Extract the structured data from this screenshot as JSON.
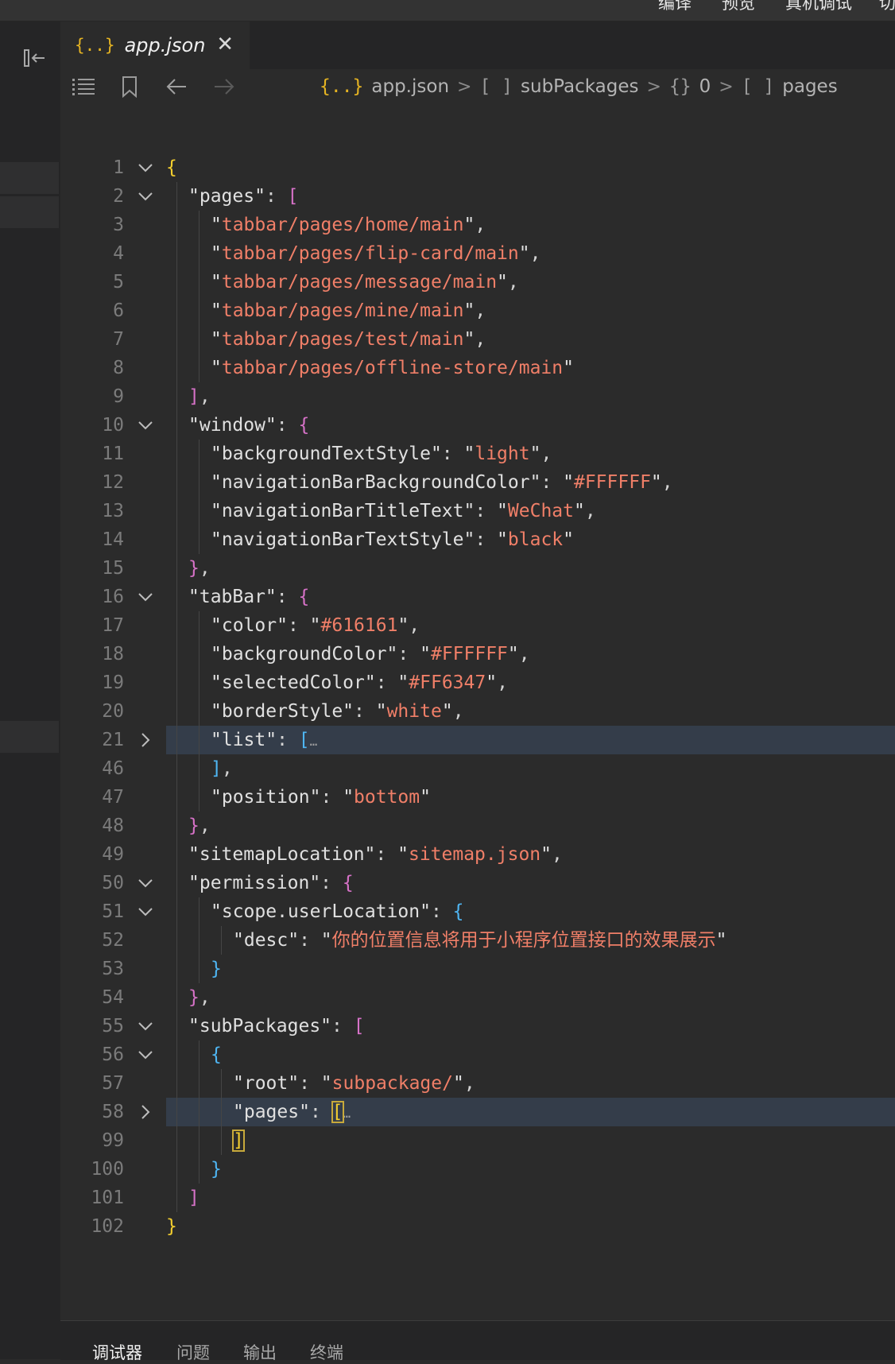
{
  "topbar": {
    "items": [
      "编译",
      "预览",
      "真机调试",
      "切"
    ]
  },
  "tab": {
    "label": "app.json",
    "icon": "json-braces-icon"
  },
  "breadcrumb": {
    "items": [
      {
        "glyph": "{..}",
        "text": "app.json"
      },
      {
        "glyph": "[ ]",
        "text": "subPackages"
      },
      {
        "glyph": "{}",
        "text": "0"
      },
      {
        "glyph": "[ ]",
        "text": "pages"
      }
    ]
  },
  "colors": {
    "string": "#f07f68",
    "bracket_level0": "#f4cf2e",
    "bracket_level1": "#d772c8",
    "bracket_level2": "#4fb6f3",
    "line_highlight": "#343d4a"
  },
  "editor": {
    "lines": [
      {
        "num": "1",
        "fold": "open",
        "indent": 0,
        "tokens": [
          [
            "b0",
            "{"
          ]
        ]
      },
      {
        "num": "2",
        "fold": "open",
        "indent": 1,
        "tokens": [
          [
            "key",
            "\"pages\""
          ],
          [
            "punc",
            ": "
          ],
          [
            "b1",
            "["
          ]
        ]
      },
      {
        "num": "3",
        "indent": 2,
        "tokens": [
          [
            "key",
            "\""
          ],
          [
            "str",
            "tabbar/pages/home/main"
          ],
          [
            "key",
            "\""
          ],
          [
            "punc",
            ","
          ]
        ]
      },
      {
        "num": "4",
        "indent": 2,
        "tokens": [
          [
            "key",
            "\""
          ],
          [
            "str",
            "tabbar/pages/flip-card/main"
          ],
          [
            "key",
            "\""
          ],
          [
            "punc",
            ","
          ]
        ]
      },
      {
        "num": "5",
        "indent": 2,
        "tokens": [
          [
            "key",
            "\""
          ],
          [
            "str",
            "tabbar/pages/message/main"
          ],
          [
            "key",
            "\""
          ],
          [
            "punc",
            ","
          ]
        ]
      },
      {
        "num": "6",
        "indent": 2,
        "tokens": [
          [
            "key",
            "\""
          ],
          [
            "str",
            "tabbar/pages/mine/main"
          ],
          [
            "key",
            "\""
          ],
          [
            "punc",
            ","
          ]
        ]
      },
      {
        "num": "7",
        "indent": 2,
        "tokens": [
          [
            "key",
            "\""
          ],
          [
            "str",
            "tabbar/pages/test/main"
          ],
          [
            "key",
            "\""
          ],
          [
            "punc",
            ","
          ]
        ]
      },
      {
        "num": "8",
        "indent": 2,
        "tokens": [
          [
            "key",
            "\""
          ],
          [
            "str",
            "tabbar/pages/offline-store/main"
          ],
          [
            "key",
            "\""
          ]
        ]
      },
      {
        "num": "9",
        "indent": 1,
        "tokens": [
          [
            "b1",
            "]"
          ],
          [
            "punc",
            ","
          ]
        ]
      },
      {
        "num": "10",
        "fold": "open",
        "indent": 1,
        "tokens": [
          [
            "key",
            "\"window\""
          ],
          [
            "punc",
            ": "
          ],
          [
            "b1",
            "{"
          ]
        ]
      },
      {
        "num": "11",
        "indent": 2,
        "tokens": [
          [
            "key",
            "\"backgroundTextStyle\""
          ],
          [
            "punc",
            ": "
          ],
          [
            "key",
            "\""
          ],
          [
            "str",
            "light"
          ],
          [
            "key",
            "\""
          ],
          [
            "punc",
            ","
          ]
        ]
      },
      {
        "num": "12",
        "indent": 2,
        "tokens": [
          [
            "key",
            "\"navigationBarBackgroundColor\""
          ],
          [
            "punc",
            ": "
          ],
          [
            "key",
            "\""
          ],
          [
            "str",
            "#FFFFFF"
          ],
          [
            "key",
            "\""
          ],
          [
            "punc",
            ","
          ]
        ]
      },
      {
        "num": "13",
        "indent": 2,
        "tokens": [
          [
            "key",
            "\"navigationBarTitleText\""
          ],
          [
            "punc",
            ": "
          ],
          [
            "key",
            "\""
          ],
          [
            "str",
            "WeChat"
          ],
          [
            "key",
            "\""
          ],
          [
            "punc",
            ","
          ]
        ]
      },
      {
        "num": "14",
        "indent": 2,
        "tokens": [
          [
            "key",
            "\"navigationBarTextStyle\""
          ],
          [
            "punc",
            ": "
          ],
          [
            "key",
            "\""
          ],
          [
            "str",
            "black"
          ],
          [
            "key",
            "\""
          ]
        ]
      },
      {
        "num": "15",
        "indent": 1,
        "tokens": [
          [
            "b1",
            "}"
          ],
          [
            "punc",
            ","
          ]
        ]
      },
      {
        "num": "16",
        "fold": "open",
        "indent": 1,
        "tokens": [
          [
            "key",
            "\"tabBar\""
          ],
          [
            "punc",
            ": "
          ],
          [
            "b1",
            "{"
          ]
        ]
      },
      {
        "num": "17",
        "indent": 2,
        "tokens": [
          [
            "key",
            "\"color\""
          ],
          [
            "punc",
            ": "
          ],
          [
            "key",
            "\""
          ],
          [
            "str",
            "#616161"
          ],
          [
            "key",
            "\""
          ],
          [
            "punc",
            ","
          ]
        ]
      },
      {
        "num": "18",
        "indent": 2,
        "tokens": [
          [
            "key",
            "\"backgroundColor\""
          ],
          [
            "punc",
            ": "
          ],
          [
            "key",
            "\""
          ],
          [
            "str",
            "#FFFFFF"
          ],
          [
            "key",
            "\""
          ],
          [
            "punc",
            ","
          ]
        ]
      },
      {
        "num": "19",
        "indent": 2,
        "tokens": [
          [
            "key",
            "\"selectedColor\""
          ],
          [
            "punc",
            ": "
          ],
          [
            "key",
            "\""
          ],
          [
            "str",
            "#FF6347"
          ],
          [
            "key",
            "\""
          ],
          [
            "punc",
            ","
          ]
        ]
      },
      {
        "num": "20",
        "indent": 2,
        "tokens": [
          [
            "key",
            "\"borderStyle\""
          ],
          [
            "punc",
            ": "
          ],
          [
            "key",
            "\""
          ],
          [
            "str",
            "white"
          ],
          [
            "key",
            "\""
          ],
          [
            "punc",
            ","
          ]
        ]
      },
      {
        "num": "21",
        "fold": "closed",
        "highlight": true,
        "indent": 2,
        "tokens": [
          [
            "key",
            "\"list\""
          ],
          [
            "punc",
            ": "
          ],
          [
            "b2",
            "["
          ],
          [
            "ell",
            "…"
          ]
        ]
      },
      {
        "num": "46",
        "indent": 2,
        "tokens": [
          [
            "b2",
            "]"
          ],
          [
            "punc",
            ","
          ]
        ]
      },
      {
        "num": "47",
        "indent": 2,
        "tokens": [
          [
            "key",
            "\"position\""
          ],
          [
            "punc",
            ": "
          ],
          [
            "key",
            "\""
          ],
          [
            "str",
            "bottom"
          ],
          [
            "key",
            "\""
          ]
        ]
      },
      {
        "num": "48",
        "indent": 1,
        "tokens": [
          [
            "b1",
            "}"
          ],
          [
            "punc",
            ","
          ]
        ]
      },
      {
        "num": "49",
        "indent": 1,
        "tokens": [
          [
            "key",
            "\"sitemapLocation\""
          ],
          [
            "punc",
            ": "
          ],
          [
            "key",
            "\""
          ],
          [
            "str",
            "sitemap.json"
          ],
          [
            "key",
            "\""
          ],
          [
            "punc",
            ","
          ]
        ]
      },
      {
        "num": "50",
        "fold": "open",
        "indent": 1,
        "tokens": [
          [
            "key",
            "\"permission\""
          ],
          [
            "punc",
            ": "
          ],
          [
            "b1",
            "{"
          ]
        ]
      },
      {
        "num": "51",
        "fold": "open",
        "indent": 2,
        "tokens": [
          [
            "key",
            "\"scope.userLocation\""
          ],
          [
            "punc",
            ": "
          ],
          [
            "b2",
            "{"
          ]
        ]
      },
      {
        "num": "52",
        "indent": 3,
        "tokens": [
          [
            "key",
            "\"desc\""
          ],
          [
            "punc",
            ": "
          ],
          [
            "key",
            "\""
          ],
          [
            "str",
            "你的位置信息将用于小程序位置接口的效果展示"
          ],
          [
            "key",
            "\""
          ]
        ]
      },
      {
        "num": "53",
        "indent": 2,
        "tokens": [
          [
            "b2",
            "}"
          ]
        ]
      },
      {
        "num": "54",
        "indent": 1,
        "tokens": [
          [
            "b1",
            "}"
          ],
          [
            "punc",
            ","
          ]
        ]
      },
      {
        "num": "55",
        "fold": "open",
        "indent": 1,
        "tokens": [
          [
            "key",
            "\"subPackages\""
          ],
          [
            "punc",
            ": "
          ],
          [
            "b1",
            "["
          ]
        ]
      },
      {
        "num": "56",
        "fold": "open",
        "indent": 2,
        "tokens": [
          [
            "b2",
            "{"
          ]
        ]
      },
      {
        "num": "57",
        "indent": 3,
        "tokens": [
          [
            "key",
            "\"root\""
          ],
          [
            "punc",
            ": "
          ],
          [
            "key",
            "\""
          ],
          [
            "str",
            "subpackage/"
          ],
          [
            "key",
            "\""
          ],
          [
            "punc",
            ","
          ]
        ]
      },
      {
        "num": "58",
        "fold": "closed",
        "highlight": true,
        "indent": 3,
        "tokens": [
          [
            "key",
            "\"pages\""
          ],
          [
            "punc",
            ": "
          ],
          [
            "b0m",
            "["
          ],
          [
            "ell",
            "…"
          ]
        ]
      },
      {
        "num": "99",
        "indent": 3,
        "tokens": [
          [
            "b0m",
            "]"
          ]
        ]
      },
      {
        "num": "100",
        "indent": 2,
        "tokens": [
          [
            "b2",
            "}"
          ]
        ]
      },
      {
        "num": "101",
        "indent": 1,
        "tokens": [
          [
            "b1",
            "]"
          ]
        ]
      },
      {
        "num": "102",
        "indent": 0,
        "tokens": [
          [
            "b0",
            "}"
          ]
        ]
      }
    ]
  },
  "panel": {
    "tabs": [
      "调试器",
      "问题",
      "输出",
      "终端"
    ]
  }
}
